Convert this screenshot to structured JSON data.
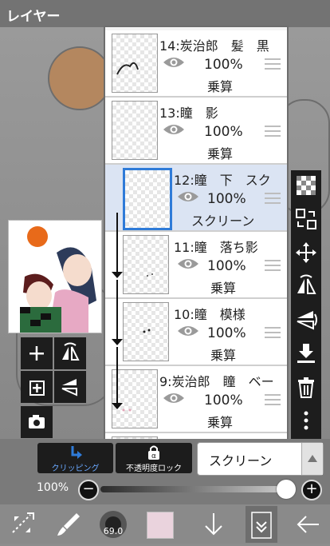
{
  "title": "レイヤー",
  "layers": [
    {
      "name": "14:炭治郎　髪　黒",
      "opacity": "100%",
      "blend": "乗算",
      "selected": false,
      "clipped": false
    },
    {
      "name": "13:瞳　影",
      "opacity": "100%",
      "blend": "乗算",
      "selected": false,
      "clipped": false
    },
    {
      "name": "12:瞳　下　スク",
      "opacity": "100%",
      "blend": "スクリーン",
      "selected": true,
      "clipped": true
    },
    {
      "name": "11:瞳　落ち影",
      "opacity": "100%",
      "blend": "乗算",
      "selected": false,
      "clipped": true
    },
    {
      "name": "10:瞳　模様",
      "opacity": "100%",
      "blend": "乗算",
      "selected": false,
      "clipped": true
    },
    {
      "name": "9:炭治郎　瞳　ベー",
      "opacity": "100%",
      "blend": "乗算",
      "selected": false,
      "clipped": false
    }
  ],
  "controls": {
    "clipping_label": "クリッピング",
    "lock_label": "不透明度ロック",
    "blend_mode": "スクリーン",
    "opacity_label": "100%",
    "opacity_value": 1.0
  },
  "brush_size": "69.0",
  "colors": {
    "accent": "#2f7bd8",
    "selected_row": "#dbe4f3",
    "current_color": "#ead3dd"
  },
  "icons": {
    "right_tools": [
      "transparent-fill-icon",
      "swap-layers-icon",
      "move-icon",
      "flip-horizontal-icon",
      "flip-vertical-icon",
      "merge-down-icon",
      "trash-icon",
      "more-icon"
    ],
    "left_tools": [
      "add-layer-icon",
      "flip-h-icon",
      "add-8bit-layer-icon",
      "flip-v-icon",
      "camera-icon"
    ],
    "bottom_tools": [
      "transform-icon",
      "brush-icon",
      "brush-size-icon",
      "color-swatch-icon",
      "arrow-down-icon",
      "layers-icon",
      "back-icon"
    ]
  }
}
